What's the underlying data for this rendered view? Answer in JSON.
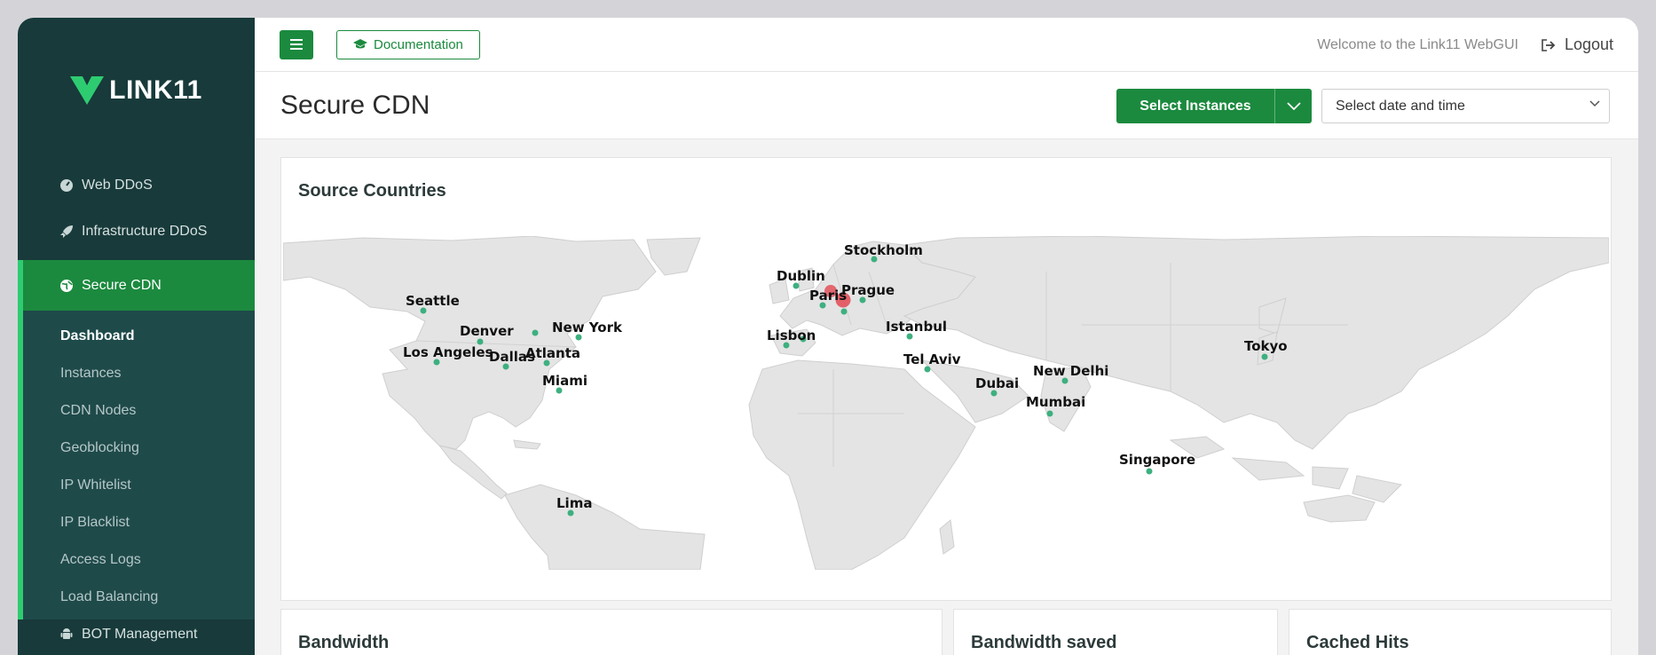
{
  "brand": {
    "name": "LINK11"
  },
  "sidebar": {
    "items": [
      {
        "label": "Web DDoS",
        "icon": "gauge-icon"
      },
      {
        "label": "Infrastructure DDoS",
        "icon": "rocket-icon"
      },
      {
        "label": "Secure CDN",
        "icon": "globe-icon",
        "active": true
      }
    ],
    "subitems": [
      {
        "label": "Dashboard",
        "current": true
      },
      {
        "label": "Instances"
      },
      {
        "label": "CDN Nodes"
      },
      {
        "label": "Geoblocking"
      },
      {
        "label": "IP Whitelist"
      },
      {
        "label": "IP Blacklist"
      },
      {
        "label": "Access Logs"
      },
      {
        "label": "Load Balancing"
      }
    ],
    "bottom_item": {
      "label": "BOT Management",
      "icon": "android-icon"
    }
  },
  "topbar": {
    "menu_icon": "hamburger-icon",
    "documentation_label": "Documentation",
    "documentation_icon": "graduation-cap-icon",
    "welcome_text": "Welcome to the Link11 WebGUI",
    "logout_label": "Logout",
    "logout_icon": "sign-out-icon"
  },
  "header": {
    "title": "Secure CDN",
    "select_instances_label": "Select Instances",
    "date_placeholder": "Select date and time"
  },
  "map_card": {
    "title": "Source Countries",
    "zoom_in": "+",
    "zoom_out": "-",
    "cities": [
      "Seattle",
      "Denver",
      "New York",
      "Los Angeles",
      "Dallas",
      "Atlanta",
      "Miami",
      "Lima",
      "Dublin",
      "Stockholm",
      "Paris",
      "Prague",
      "Lisbon",
      "Istanbul",
      "Tel Aviv",
      "Dubai",
      "New Delhi",
      "Mumbai",
      "Singapore",
      "Tokyo"
    ]
  },
  "bottom_cards": {
    "bandwidth": "Bandwidth",
    "bandwidth_saved": "Bandwidth saved",
    "cached_hits": "Cached Hits"
  },
  "colors": {
    "sidebar_bg": "#183a3a",
    "accent_green": "#1b8a3e",
    "node_dot": "#3db07f",
    "traffic_bubble": "#e2515b",
    "land": "#e4e4e4"
  }
}
